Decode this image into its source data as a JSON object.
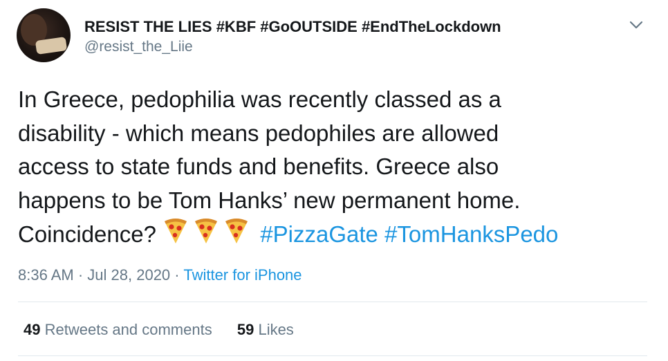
{
  "user": {
    "display_name": "RESIST THE LIES #KBF #GoOUTSIDE #EndTheLockdown",
    "handle": "@resist_the_Liie",
    "avatar_icon": "profile-photo"
  },
  "menu_icon": "chevron-down-icon",
  "tweet": {
    "lines": [
      "In Greece, pedophilia was recently classed as a",
      "disability - which means pedophiles are allowed",
      "access to state funds and benefits. Greece also",
      "happens to be Tom Hanks’ new permanent home."
    ],
    "last_line_text": "Coincidence?",
    "emoji": [
      "pizza-emoji",
      "pizza-emoji",
      "pizza-emoji"
    ],
    "hashtags": [
      "#PizzaGate",
      "#TomHanksPedo"
    ]
  },
  "meta": {
    "time": "8:36 AM",
    "separator": "·",
    "date": "Jul 28, 2020",
    "source": "Twitter for iPhone"
  },
  "stats": {
    "retweets_count": "49",
    "retweets_label": "Retweets and comments",
    "likes_count": "59",
    "likes_label": "Likes"
  },
  "colors": {
    "text": "#14171a",
    "secondary": "#657786",
    "link": "#1b95e0",
    "divider": "#e1e8ed"
  }
}
